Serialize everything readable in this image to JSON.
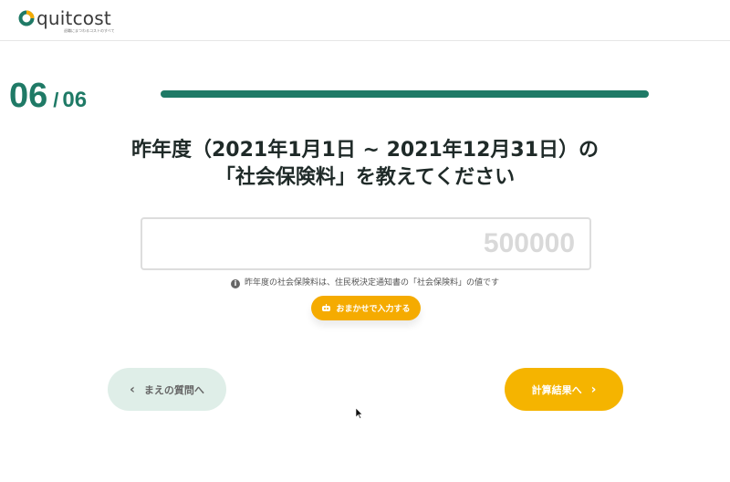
{
  "brand": {
    "name": "quitcost",
    "tagline": "退職にまつわるコストのすべて",
    "accent_color": "#1f7a66",
    "logo_color": "#f5ab00"
  },
  "progress": {
    "current": "06",
    "separator": "/",
    "total": "06",
    "fraction": 1.0
  },
  "question": {
    "line1": "昨年度（2021年1月1日 ~ 2021年12月31日）の",
    "line2": "「社会保険料」を教えてください"
  },
  "answer_input": {
    "value": "",
    "placeholder": "500000"
  },
  "hint": {
    "icon": "info-icon",
    "text": "昨年度の社会保険料は、住民税決定通知書の「社会保険料」の値です"
  },
  "auto_fill_button": {
    "icon": "robot-icon",
    "label": "おまかせで入力する",
    "color": "#f5ab00"
  },
  "nav": {
    "back_label": "まえの質問へ",
    "back_icon": "chevron-left-icon",
    "next_label": "計算結果へ",
    "next_icon": "chevron-right-icon",
    "next_color": "#f5b400"
  }
}
